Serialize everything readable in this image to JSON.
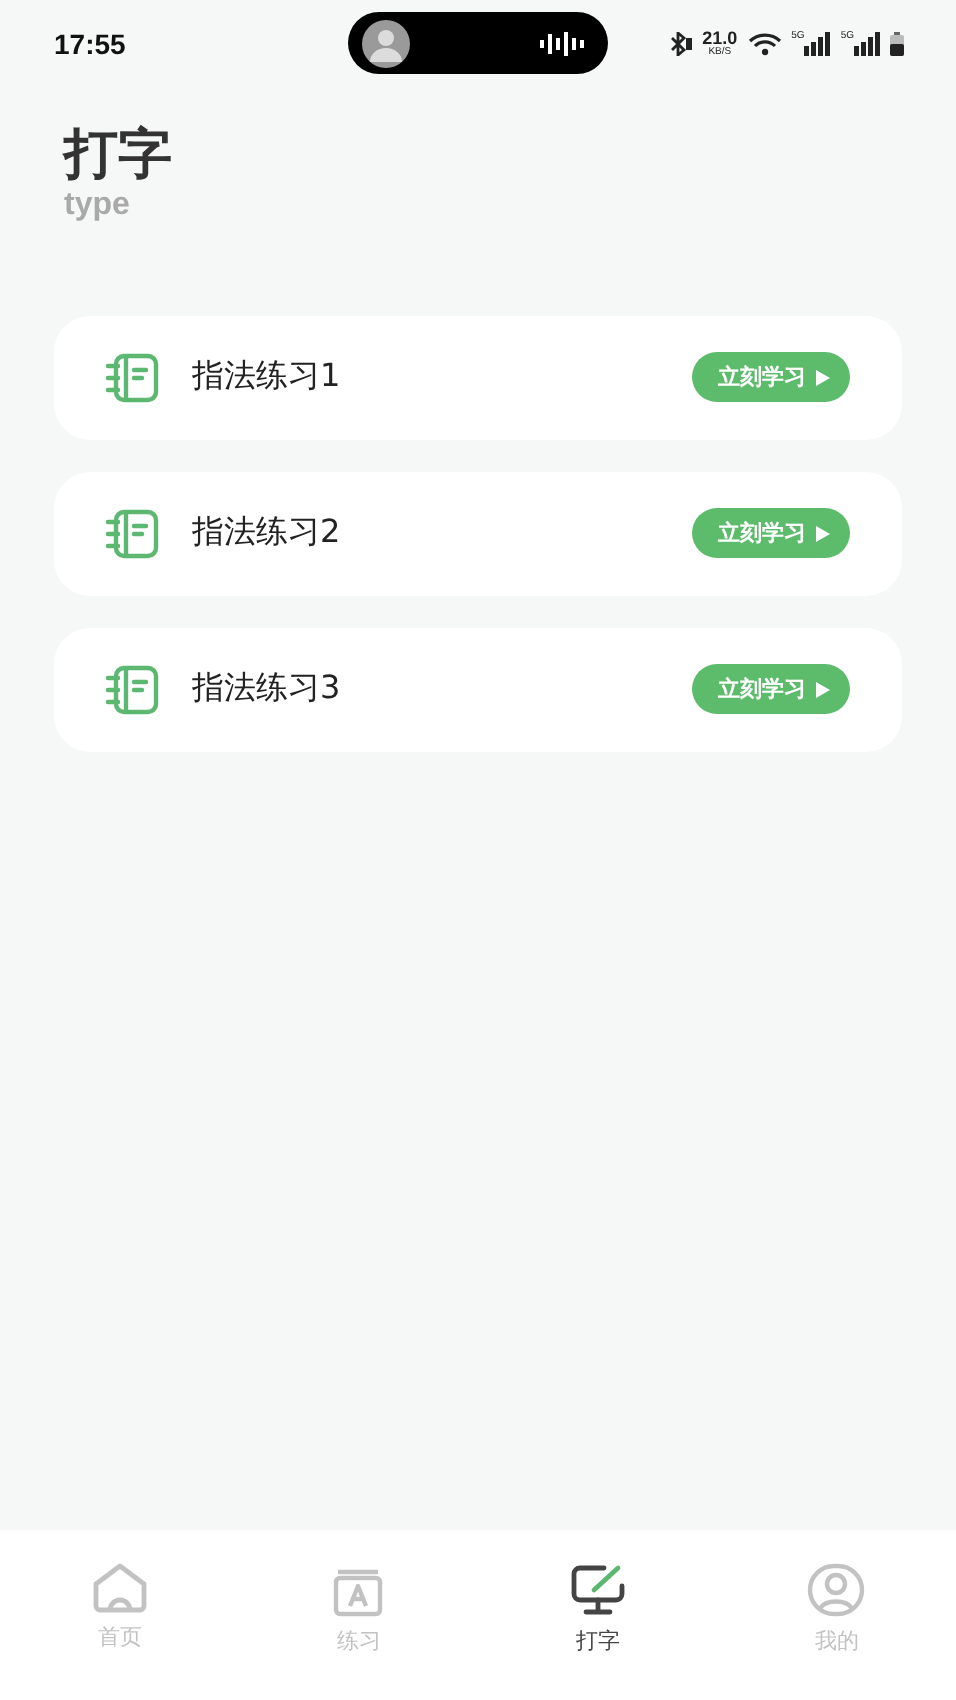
{
  "status_bar": {
    "time": "17:55",
    "net_speed": "21.0",
    "net_unit": "KB/S",
    "signal_1": "5G",
    "signal_2": "5G"
  },
  "header": {
    "title": "打字",
    "subtitle": "type"
  },
  "lessons": [
    {
      "title": "指法练习1",
      "action": "立刻学习"
    },
    {
      "title": "指法练习2",
      "action": "立刻学习"
    },
    {
      "title": "指法练习3",
      "action": "立刻学习"
    }
  ],
  "tab_bar": [
    {
      "kind": "home",
      "label": "首页",
      "selected": false
    },
    {
      "kind": "practice",
      "label": "练习",
      "selected": false
    },
    {
      "kind": "typing",
      "label": "打字",
      "selected": true
    },
    {
      "kind": "profile",
      "label": "我的",
      "selected": false
    }
  ]
}
